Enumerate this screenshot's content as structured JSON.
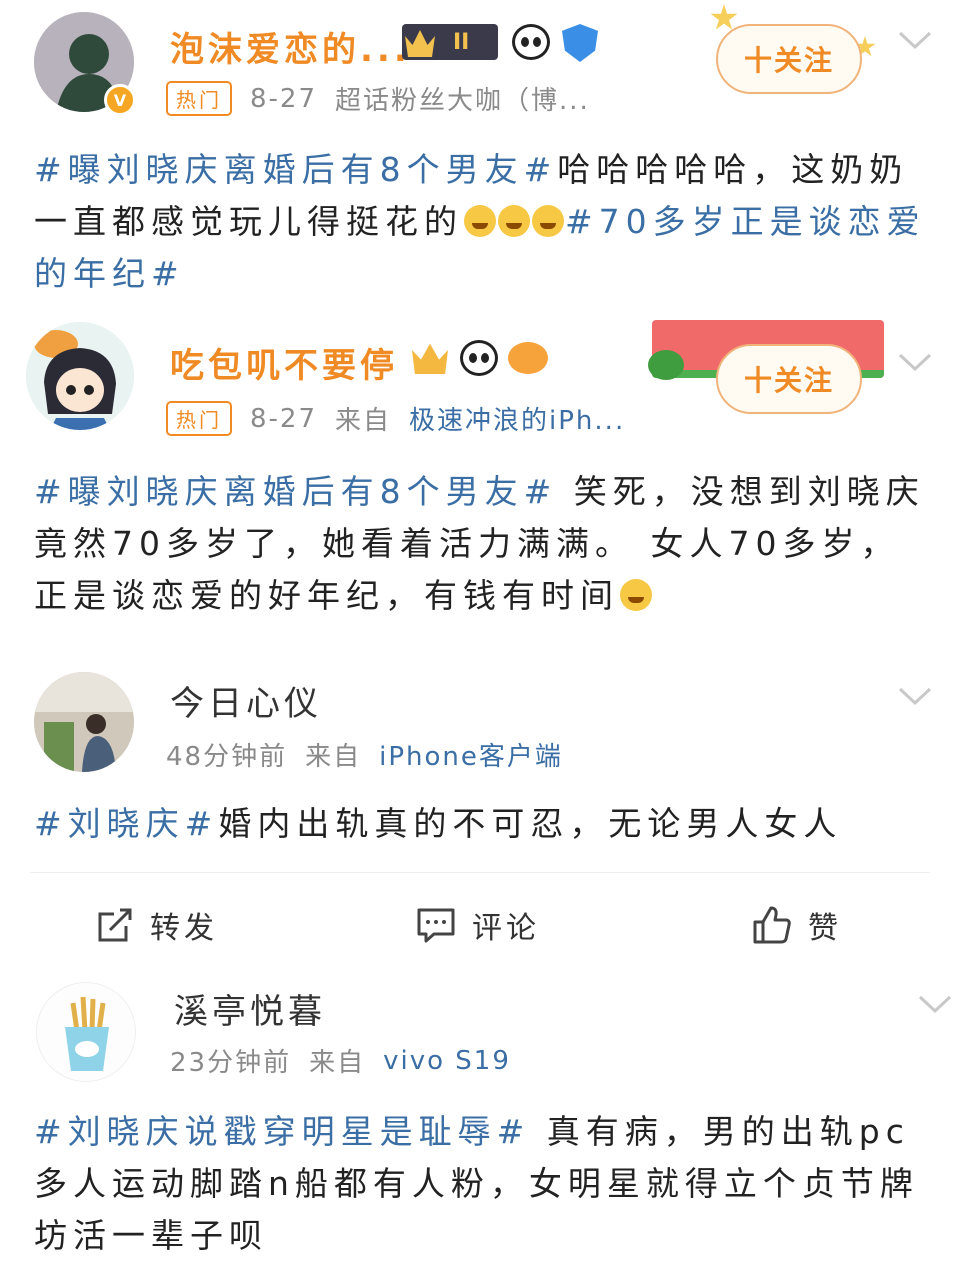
{
  "posts": [
    {
      "username": "泡沫爱恋的...",
      "hot": "热门",
      "date": "8-27",
      "source": "超话粉丝大咖（博...",
      "follow": "十关注",
      "tag1": "#曝刘晓庆离婚后有8个男友#",
      "text1": "哈哈哈哈哈，这奶奶一直都感觉玩儿得挺花的",
      "tag2": "#70多岁正是谈恋爱的年纪#",
      "badge_level": "II"
    },
    {
      "username": "吃包叽不要停",
      "hot": "热门",
      "date": "8-27",
      "from": "来自",
      "source": "极速冲浪的iPh...",
      "follow": "十关注",
      "tag1": "#曝刘晓庆离婚后有8个男友#",
      "text1": " 笑死，没想到刘晓庆竟然70多岁了，她看着活力满满。 女人70多岁，正是谈恋爱的好年纪，有钱有时间"
    },
    {
      "username": "今日心仪",
      "time": "48分钟前",
      "from": "来自",
      "source": "iPhone客户端",
      "tag1": "#刘晓庆#",
      "text1": "婚内出轨真的不可忍，无论男人女人"
    },
    {
      "username": "溪亭悦暮",
      "time": "23分钟前",
      "from": "来自",
      "source": "vivo S19",
      "tag1": "#刘晓庆说戳穿明星是耻辱#",
      "text1": " 真有病，男的出轨pc多人运动脚踏n船都有人粉，女明星就得立个贞节牌坊活一辈子呗"
    }
  ],
  "actions": {
    "repost": "转发",
    "comment": "评论",
    "like": "赞"
  },
  "colors": {
    "accent_orange": "#f08a24",
    "link_blue": "#3a6ea5"
  }
}
